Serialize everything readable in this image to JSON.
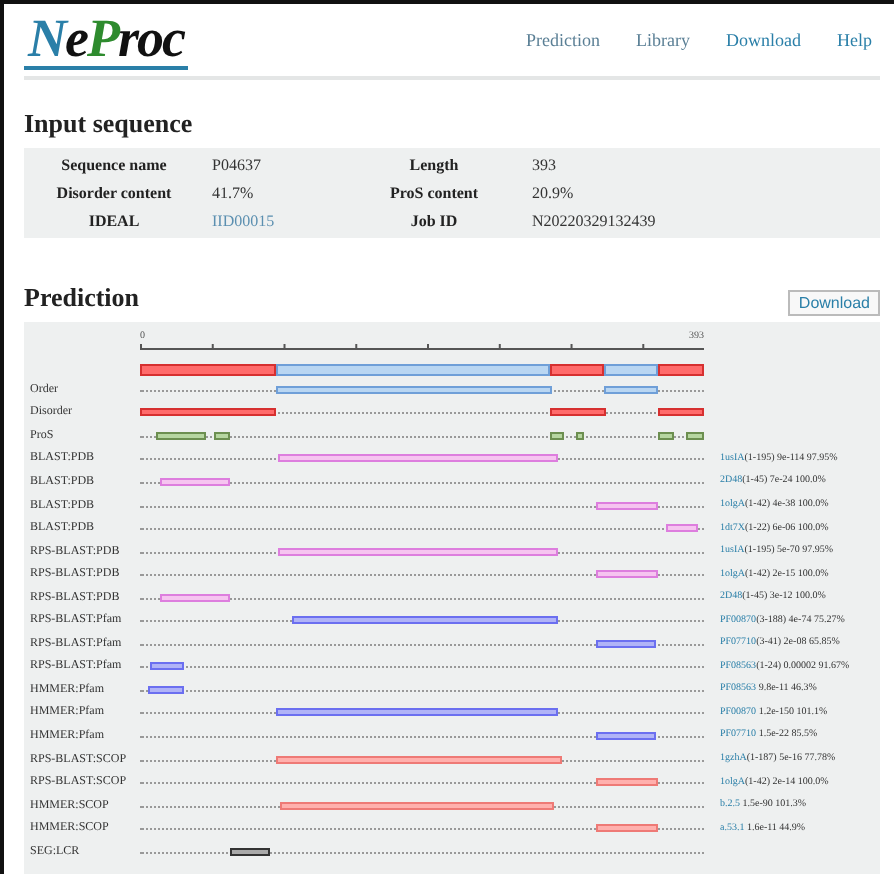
{
  "header": {
    "logo": [
      {
        "text": "N",
        "color": "#2a7fa8"
      },
      {
        "text": "e",
        "color": "#111111"
      },
      {
        "text": "P",
        "color": "#2e8b2e"
      },
      {
        "text": "roc",
        "color": "#111111"
      }
    ],
    "nav": [
      "Prediction",
      "Library",
      "Download",
      "Help"
    ]
  },
  "input": {
    "title": "Input sequence",
    "rows": [
      [
        {
          "label": "Sequence name",
          "value": "P04637",
          "link": false
        },
        {
          "label": "Length",
          "value": "393",
          "link": false
        }
      ],
      [
        {
          "label": "Disorder content",
          "value": "41.7%",
          "link": false
        },
        {
          "label": "ProS content",
          "value": "20.9%",
          "link": false
        }
      ],
      [
        {
          "label": "IDEAL",
          "value": "IID00015",
          "link": true
        },
        {
          "label": "Job ID",
          "value": "N20220329132439",
          "link": false
        }
      ]
    ]
  },
  "prediction": {
    "title": "Prediction",
    "download": "Download",
    "axis": {
      "start": "0",
      "end": "393"
    },
    "overview": [
      {
        "kind": "disorder"
      },
      {
        "kind": "order"
      },
      {
        "kind": "disorder"
      },
      {
        "kind": "order"
      },
      {
        "kind": "disorder"
      }
    ],
    "tracks": [
      {
        "label": "Order",
        "kind": "order"
      },
      {
        "label": "Disorder",
        "kind": "disorder"
      },
      {
        "label": "ProS",
        "kind": "pros"
      },
      {
        "label": "BLAST:PDB",
        "kind": "pdb",
        "hit": "1usIA",
        "detail": "(1-195) 9e-114 97.95%"
      },
      {
        "label": "BLAST:PDB",
        "kind": "pdb",
        "hit": "2D48",
        "detail": "(1-45) 7e-24 100.0%"
      },
      {
        "label": "BLAST:PDB",
        "kind": "pdb",
        "hit": "1olgA",
        "detail": "(1-42) 4e-38 100.0%"
      },
      {
        "label": "BLAST:PDB",
        "kind": "pdb",
        "hit": "1dt7X",
        "detail": "(1-22) 6e-06 100.0%"
      },
      {
        "label": "RPS-BLAST:PDB",
        "kind": "pdb",
        "hit": "1usIA",
        "detail": "(1-195) 5e-70 97.95%"
      },
      {
        "label": "RPS-BLAST:PDB",
        "kind": "pdb",
        "hit": "1olgA",
        "detail": "(1-42) 2e-15 100.0%"
      },
      {
        "label": "RPS-BLAST:PDB",
        "kind": "pdb",
        "hit": "2D48",
        "detail": "(1-45) 3e-12 100.0%"
      },
      {
        "label": "RPS-BLAST:Pfam",
        "kind": "pfam",
        "hit": "PF00870",
        "detail": "(3-188) 4e-74 75.27%"
      },
      {
        "label": "RPS-BLAST:Pfam",
        "kind": "pfam",
        "hit": "PF07710",
        "detail": "(3-41) 2e-08 65.85%"
      },
      {
        "label": "RPS-BLAST:Pfam",
        "kind": "pfam",
        "hit": "PF08563",
        "detail": "(1-24) 0.00002 91.67%"
      },
      {
        "label": "HMMER:Pfam",
        "kind": "pfam",
        "hit": "PF08563",
        "detail": " 9.8e-11 46.3%"
      },
      {
        "label": "HMMER:Pfam",
        "kind": "pfam",
        "hit": "PF00870",
        "detail": " 1.2e-150 101.1%"
      },
      {
        "label": "HMMER:Pfam",
        "kind": "pfam",
        "hit": "PF07710",
        "detail": " 1.5e-22 85.5%"
      },
      {
        "label": "RPS-BLAST:SCOP",
        "kind": "scop",
        "hit": "1gzhA",
        "detail": "(1-187) 5e-16 77.78%"
      },
      {
        "label": "RPS-BLAST:SCOP",
        "kind": "scop",
        "hit": "1olgA",
        "detail": "(1-42) 2e-14 100.0%"
      },
      {
        "label": "HMMER:SCOP",
        "kind": "scop",
        "hit": "b.2.5",
        "detail": " 1.5e-90 101.3%"
      },
      {
        "label": "HMMER:SCOP",
        "kind": "scop",
        "hit": "a.53.1",
        "detail": " 1.6e-11 44.9%"
      },
      {
        "label": "SEG:LCR",
        "kind": "lcr"
      }
    ]
  }
}
